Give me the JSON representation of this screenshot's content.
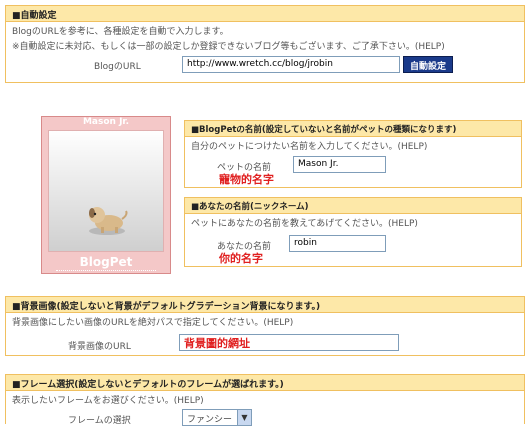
{
  "auto": {
    "header": "■自動設定",
    "desc_line1": "BlogのURLを参考に、各種設定を自動で入力します。",
    "desc_line2": "※自動設定に未対応、もしくは一部の設定しか登録できないブログ等もございます、ご了承下さい。(HELP)",
    "url_label": "BlogのURL",
    "url_value": "http://www.wretch.cc/blog/jrobin",
    "button_label": "自動設定"
  },
  "pet_preview": {
    "name": "Mason Jr.",
    "logo": "BlogPet"
  },
  "pet_name": {
    "header": "■BlogPetの名前(設定していないと名前がペットの種類になります)",
    "desc": "自分のペットにつけたい名前を入力してください。(HELP)",
    "label": "ペットの名前",
    "value": "Mason Jr.",
    "annotation": "寵物的名字"
  },
  "nickname": {
    "header": "■あなたの名前(ニックネーム)",
    "desc": "ペットにあなたの名前を教えてあげてください。(HELP)",
    "label": "あなたの名前",
    "value": "robin",
    "annotation": "你的名字"
  },
  "background": {
    "header": "■背景画像(設定しないと背景がデフォルトグラデーション背景になります。)",
    "desc": "背景画像にしたい画像のURLを絶対パスで指定してください。(HELP)",
    "label": "背景画像のURL",
    "annotation": "背景圖的網址"
  },
  "frame": {
    "header": "■フレーム選択(設定しないとデフォルトのフレームが選ばれます。)",
    "desc": "表示したいフレームをお選びください。(HELP)",
    "label": "フレームの選択",
    "selected": "ファンシー"
  },
  "colors": {
    "panel_border": "#f0c060",
    "panel_header": "#fde8a8",
    "button": "#1a3a8a",
    "annotation": "#e02020"
  }
}
